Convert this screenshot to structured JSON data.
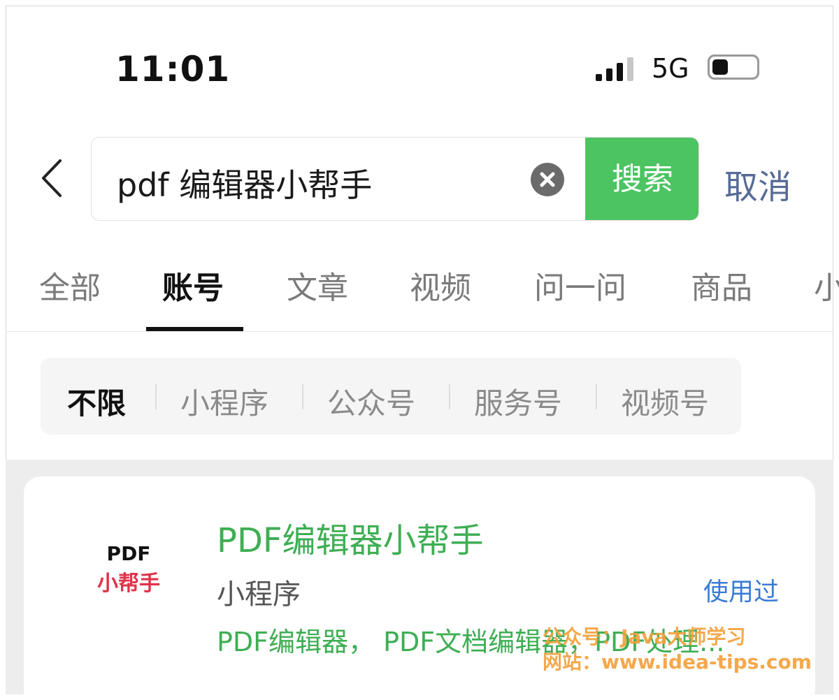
{
  "status_bar": {
    "time": "11:01",
    "network": "5G",
    "icons": [
      "signal-icon",
      "battery-icon"
    ]
  },
  "search": {
    "query": "pdf 编辑器小帮手",
    "search_button": "搜索",
    "cancel": "取消",
    "icons": [
      "back-arrow-icon",
      "clear-icon"
    ]
  },
  "tabs": {
    "items": [
      "全部",
      "账号",
      "文章",
      "视频",
      "问一问",
      "商品",
      "小"
    ],
    "active": "账号"
  },
  "filters": {
    "items": [
      "不限",
      "小程序",
      "公众号",
      "服务号",
      "视频号"
    ],
    "active": "不限"
  },
  "result": {
    "logo_top": "PDF",
    "logo_bottom": "小帮手",
    "title": "PDF编辑器小帮手",
    "type": "小程序",
    "used": "使用过",
    "description": "PDF编辑器， PDF文档编辑器，PDF处理..."
  },
  "watermark": {
    "line1": "公众号：Java大师学习",
    "line2": "网站：www.idea-tips.com"
  },
  "colors": {
    "accent_green": "#4cc461",
    "title_green": "#3fae54",
    "link_blue": "#576b95",
    "used_blue": "#3a7bd5",
    "logo_red": "#e0334a",
    "watermark_orange": "#f4a13d"
  }
}
